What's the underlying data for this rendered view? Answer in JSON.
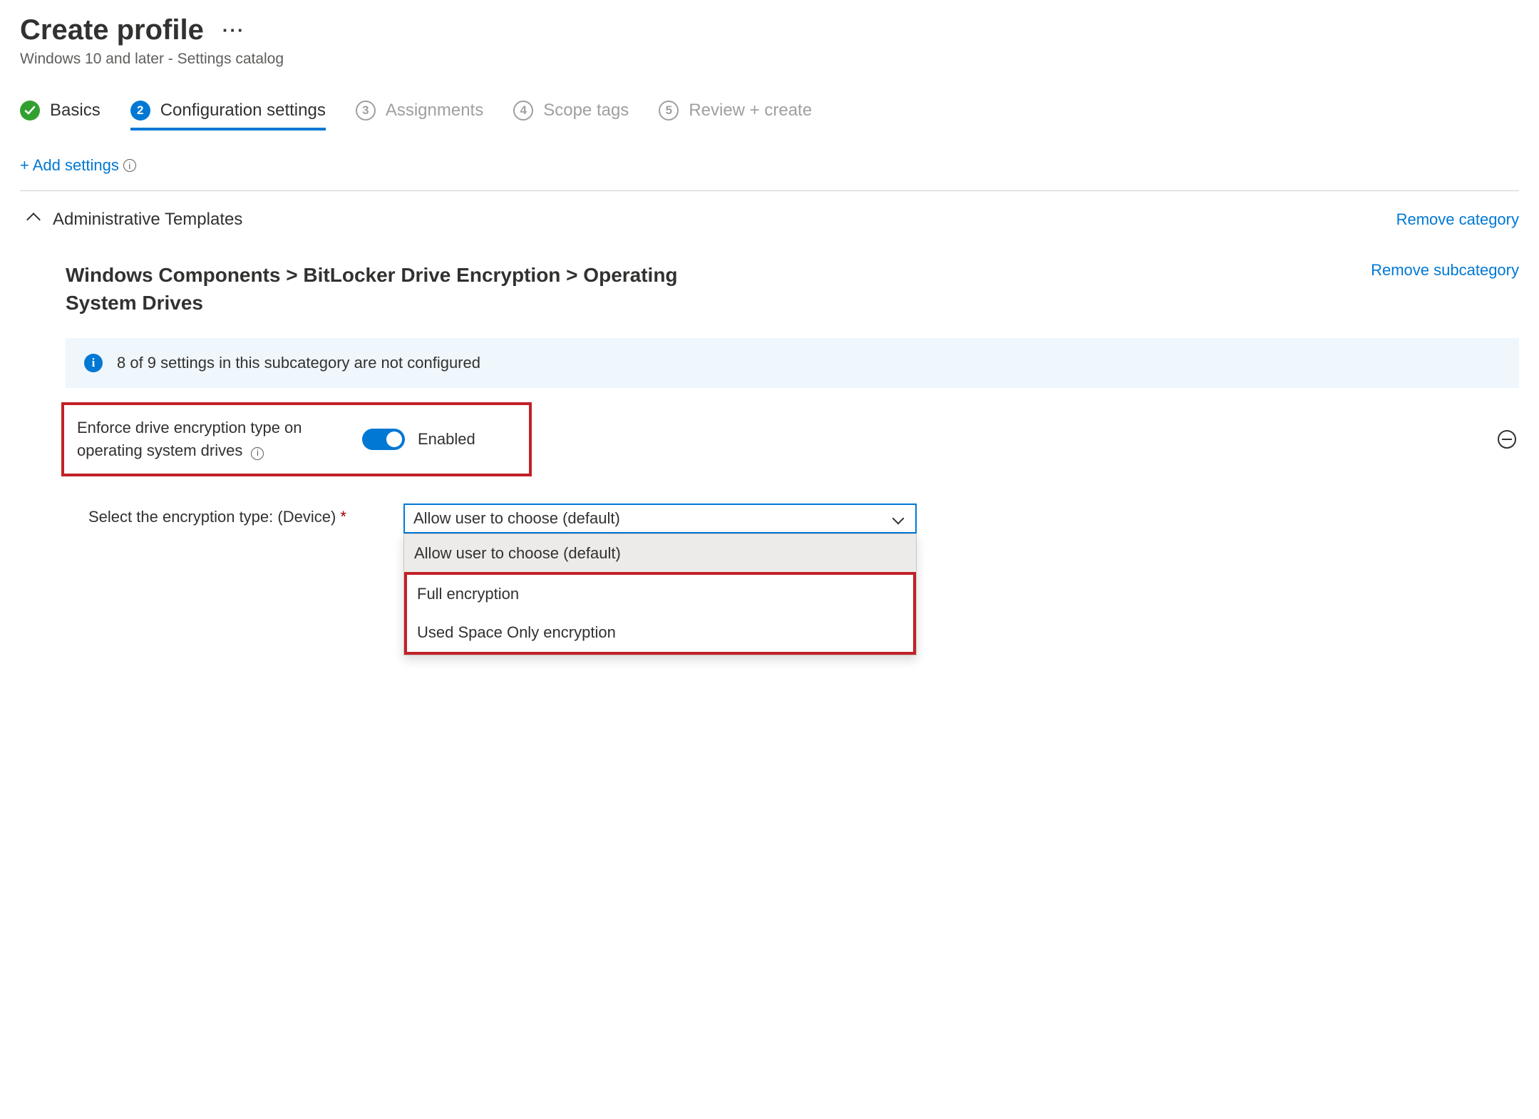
{
  "header": {
    "title": "Create profile",
    "subtitle": "Windows 10 and later - Settings catalog"
  },
  "steps": [
    {
      "num": "✓",
      "label": "Basics",
      "state": "done"
    },
    {
      "num": "2",
      "label": "Configuration settings",
      "state": "current"
    },
    {
      "num": "3",
      "label": "Assignments",
      "state": "future"
    },
    {
      "num": "4",
      "label": "Scope tags",
      "state": "future"
    },
    {
      "num": "5",
      "label": "Review + create",
      "state": "future"
    }
  ],
  "add_settings_label": "+ Add settings",
  "category": {
    "title": "Administrative Templates",
    "remove_label": "Remove category"
  },
  "subcategory": {
    "title": "Windows Components > BitLocker Drive Encryption > Operating System Drives",
    "remove_label": "Remove subcategory"
  },
  "banner_text": "8 of 9 settings in this subcategory are not configured",
  "setting": {
    "label": "Enforce drive encryption type on operating system drives",
    "state": "Enabled"
  },
  "sub_setting": {
    "label": "Select the encryption type: (Device)",
    "required": "*",
    "selected": "Allow user to choose (default)",
    "options": [
      "Allow user to choose (default)",
      "Full encryption",
      "Used Space Only encryption"
    ]
  }
}
